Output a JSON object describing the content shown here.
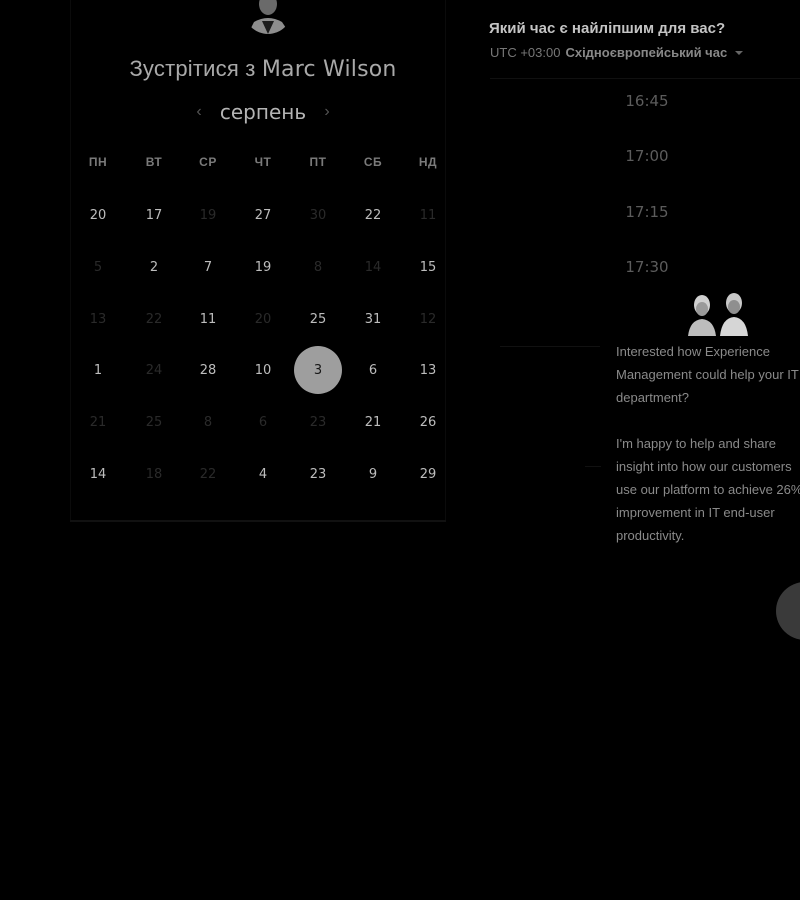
{
  "header": {
    "title_prefix": "Зустрітися з",
    "host_name": "Marc Wilson"
  },
  "calendar": {
    "month": "серпень",
    "prev_icon": "chevron-left-icon",
    "next_icon": "chevron-right-icon",
    "weekdays": [
      "ПН",
      "ВТ",
      "СР",
      "ЧТ",
      "ПТ",
      "СБ",
      "НД"
    ],
    "weeks": [
      [
        {
          "d": "20",
          "a": true
        },
        {
          "d": "17",
          "a": true
        },
        {
          "d": "19",
          "a": false
        },
        {
          "d": "27",
          "a": true
        },
        {
          "d": "30",
          "a": false
        },
        {
          "d": "22",
          "a": true
        },
        {
          "d": "11",
          "a": false
        }
      ],
      [
        {
          "d": "5",
          "a": false
        },
        {
          "d": "2",
          "a": true
        },
        {
          "d": "7",
          "a": true
        },
        {
          "d": "19",
          "a": true
        },
        {
          "d": "8",
          "a": false
        },
        {
          "d": "14",
          "a": false
        },
        {
          "d": "15",
          "a": true
        }
      ],
      [
        {
          "d": "13",
          "a": false
        },
        {
          "d": "22",
          "a": false
        },
        {
          "d": "11",
          "a": true
        },
        {
          "d": "20",
          "a": false
        },
        {
          "d": "25",
          "a": true
        },
        {
          "d": "31",
          "a": true
        },
        {
          "d": "12",
          "a": false
        }
      ],
      [
        {
          "d": "1",
          "a": true
        },
        {
          "d": "24",
          "a": false
        },
        {
          "d": "28",
          "a": true
        },
        {
          "d": "10",
          "a": true
        },
        {
          "d": "3",
          "a": true,
          "s": true
        },
        {
          "d": "6",
          "a": true
        },
        {
          "d": "13",
          "a": true
        }
      ],
      [
        {
          "d": "21",
          "a": false
        },
        {
          "d": "25",
          "a": false
        },
        {
          "d": "8",
          "a": false
        },
        {
          "d": "6",
          "a": false
        },
        {
          "d": "23",
          "a": false
        },
        {
          "d": "21",
          "a": true
        },
        {
          "d": "26",
          "a": true
        }
      ],
      [
        {
          "d": "14",
          "a": true
        },
        {
          "d": "18",
          "a": false
        },
        {
          "d": "22",
          "a": false
        },
        {
          "d": "4",
          "a": true
        },
        {
          "d": "23",
          "a": true
        },
        {
          "d": "9",
          "a": true
        },
        {
          "d": "29",
          "a": true
        }
      ]
    ]
  },
  "times": {
    "question": "Який час є найліпшим для вас?",
    "tz_offset": "UTC +03:00",
    "tz_name": "Східноєвропейський час",
    "slots": [
      "16:45",
      "17:00",
      "17:15",
      "17:30"
    ]
  },
  "chat": {
    "message_1": "Interested how Experience Management could help your IT department?",
    "message_2": "I'm happy to help and share insight into how our customers use our platform to achieve 26% improvement in IT end-user productivity."
  },
  "colors": {
    "background": "#000000",
    "selected_day": "#9e9e9e"
  }
}
